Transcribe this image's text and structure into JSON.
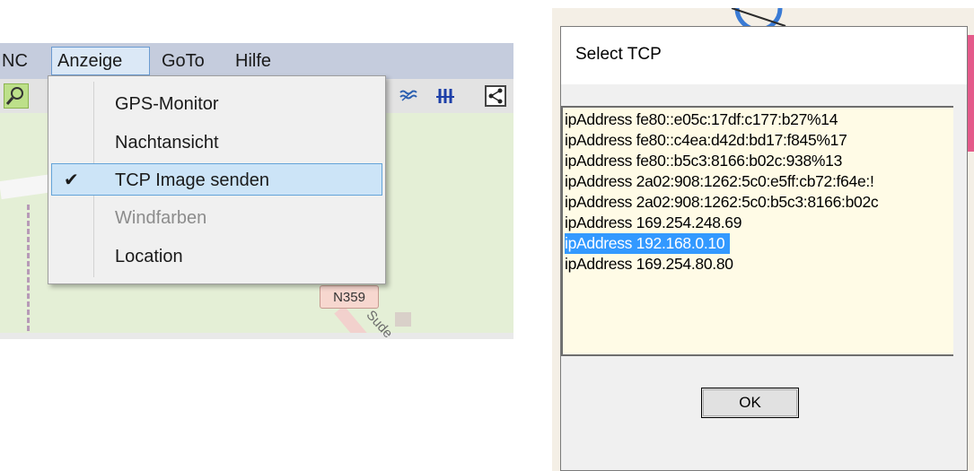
{
  "menubar": {
    "items": [
      {
        "label": "NC"
      },
      {
        "label": "Anzeige"
      },
      {
        "label": "GoTo"
      },
      {
        "label": "Hilfe"
      }
    ]
  },
  "dropdown": {
    "items": [
      {
        "label": "GPS-Monitor",
        "checked": false,
        "enabled": true
      },
      {
        "label": "Nachtansicht",
        "checked": false,
        "enabled": true
      },
      {
        "label": "TCP Image senden",
        "checked": true,
        "enabled": true
      },
      {
        "label": "Windfarben",
        "checked": false,
        "enabled": false
      },
      {
        "label": "Location",
        "checked": false,
        "enabled": true
      }
    ],
    "checkmark": "✔"
  },
  "map": {
    "road_label": "N359",
    "street_label": "Sude"
  },
  "dialog": {
    "title": "Select TCP",
    "items": [
      "ipAddress fe80::e05c:17df:c177:b27%14",
      "ipAddress fe80::c4ea:d42d:bd17:f845%17",
      "ipAddress fe80::b5c3:8166:b02c:938%13",
      "ipAddress 2a02:908:1262:5c0:e5ff:cb72:f64e:!",
      "ipAddress 2a02:908:1262:5c0:b5c3:8166:b02c",
      "ipAddress 169.254.248.69",
      "ipAddress 192.168.0.10",
      "ipAddress 169.254.80.80"
    ],
    "selected_item": "ipAddress 192.168.0.10",
    "ok_label": "OK"
  },
  "colors": {
    "menubar_bg": "#c5ccdd",
    "selection": "#3399ff",
    "listbox_bg": "#fffbe6",
    "checked_item_bg": "#cce4f7"
  }
}
